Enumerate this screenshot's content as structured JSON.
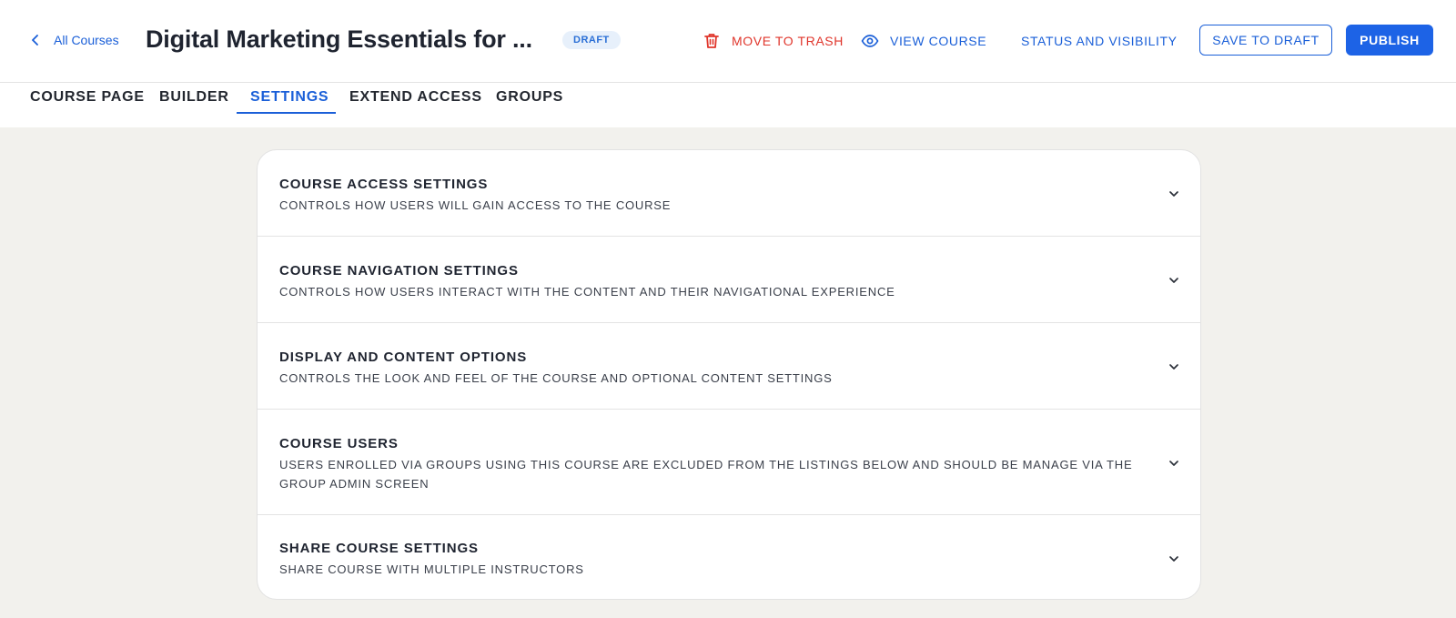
{
  "header": {
    "back_label": "All Courses",
    "title": "Digital Marketing Essentials for ...",
    "status_badge": "DRAFT",
    "actions": {
      "trash": "MOVE TO TRASH",
      "view": "VIEW COURSE",
      "status": "STATUS AND VISIBILITY"
    },
    "save_draft_label": "SAVE TO DRAFT",
    "publish_label": "PUBLISH"
  },
  "tabs": [
    {
      "label": "COURSE PAGE",
      "active": false
    },
    {
      "label": "BUILDER",
      "active": false
    },
    {
      "label": "SETTINGS",
      "active": true
    },
    {
      "label": "EXTEND ACCESS",
      "active": false
    },
    {
      "label": "GROUPS",
      "active": false
    }
  ],
  "sections": [
    {
      "title": "COURSE ACCESS SETTINGS",
      "description": "CONTROLS HOW USERS WILL GAIN ACCESS TO THE COURSE"
    },
    {
      "title": "COURSE NAVIGATION SETTINGS",
      "description": "CONTROLS HOW USERS INTERACT WITH THE CONTENT AND THEIR NAVIGATIONAL EXPERIENCE"
    },
    {
      "title": "DISPLAY AND CONTENT OPTIONS",
      "description": "CONTROLS THE LOOK AND FEEL OF THE COURSE AND OPTIONAL CONTENT SETTINGS"
    },
    {
      "title": "COURSE USERS",
      "description": "USERS ENROLLED VIA GROUPS USING THIS COURSE ARE EXCLUDED FROM THE LISTINGS BELOW AND SHOULD BE MANAGE VIA THE GROUP ADMIN SCREEN"
    },
    {
      "title": "SHARE COURSE SETTINGS",
      "description": "SHARE COURSE WITH MULTIPLE INSTRUCTORS"
    }
  ],
  "colors": {
    "accent": "#1a5fd8",
    "danger": "#e0352b",
    "background": "#f2f1ed",
    "badge_bg": "#e7f0fb"
  },
  "icons": {
    "back": "chevron-left-icon",
    "trash": "trash-icon",
    "view": "eye-icon",
    "section_toggle": "chevron-down-icon"
  }
}
